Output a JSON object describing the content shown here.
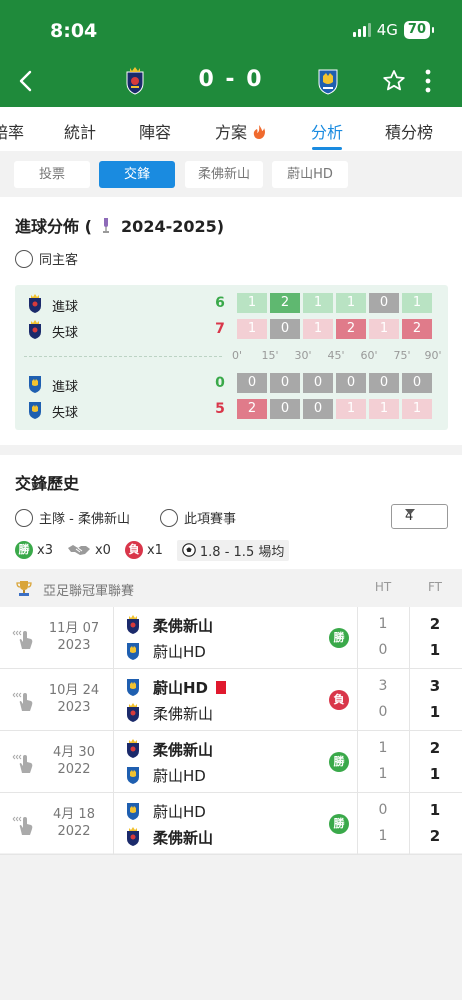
{
  "status_bar": {
    "time": "8:04",
    "network": "4G",
    "battery": "70"
  },
  "header": {
    "home_score": "0",
    "away_score": "0",
    "score_sep": "-"
  },
  "tabs": [
    {
      "label": "賠率"
    },
    {
      "label": "統計"
    },
    {
      "label": "陣容"
    },
    {
      "label": "方案"
    },
    {
      "label": "分析"
    },
    {
      "label": "積分榜"
    }
  ],
  "subtabs": [
    "投票",
    "交鋒",
    "柔佛新山",
    "蔚山HD"
  ],
  "goal_dist": {
    "title_prefix": "進球分佈 (",
    "season": "2024-2025)",
    "radio_label": "同主客",
    "home": {
      "scored": {
        "label": "進球",
        "total": "6",
        "cells": [
          "1",
          "2",
          "1",
          "1",
          "0",
          "1"
        ]
      },
      "conceded": {
        "label": "失球",
        "total": "7",
        "cells": [
          "1",
          "0",
          "1",
          "2",
          "1",
          "2"
        ]
      }
    },
    "away": {
      "scored": {
        "label": "進球",
        "total": "0",
        "cells": [
          "0",
          "0",
          "0",
          "0",
          "0",
          "0"
        ]
      },
      "conceded": {
        "label": "失球",
        "total": "5",
        "cells": [
          "2",
          "0",
          "0",
          "1",
          "1",
          "1"
        ]
      }
    },
    "time_labels": [
      "0'",
      "15'",
      "30'",
      "45'",
      "60'",
      "75'",
      "90'"
    ]
  },
  "h2h": {
    "title": "交鋒歷史",
    "radio_home": "主隊 - 柔佛新山",
    "radio_comp": "此項賽事",
    "count": "4",
    "summary": {
      "win_badge": "勝",
      "win_count": "x3",
      "draw_count": "x0",
      "loss_badge": "負",
      "loss_count": "x1",
      "avg": "1.8 - 1.5 場均"
    },
    "league": "亞足聯冠軍聯賽",
    "ht_label": "HT",
    "ft_label": "FT",
    "matches": [
      {
        "date": "11月 07",
        "year": "2023",
        "team1": "柔佛新山",
        "team2": "蔚山HD",
        "result": "勝",
        "ht1": "1",
        "ht2": "0",
        "ft1": "2",
        "ft2": "1"
      },
      {
        "date": "10月 24",
        "year": "2023",
        "team1": "蔚山HD",
        "team2": "柔佛新山",
        "result": "負",
        "ht1": "3",
        "ht2": "0",
        "ft1": "3",
        "ft2": "1"
      },
      {
        "date": "4月 30",
        "year": "2022",
        "team1": "柔佛新山",
        "team2": "蔚山HD",
        "result": "勝",
        "ht1": "1",
        "ht2": "1",
        "ft1": "2",
        "ft2": "1"
      },
      {
        "date": "4月 18",
        "year": "2022",
        "team1": "蔚山HD",
        "team2": "柔佛新山",
        "result": "勝",
        "ht1": "0",
        "ht2": "1",
        "ft1": "1",
        "ft2": "2"
      }
    ]
  },
  "colors": {
    "header_green": "#1f8a3b",
    "accent_blue": "#1a8be0",
    "win_green": "#3aa94a",
    "loss_red": "#d9364a",
    "cell_green_light": "#b9e3c3",
    "cell_green_dark": "#5fb870",
    "cell_red_light": "#f3cfd4",
    "cell_red_dark": "#e07b8a",
    "cell_gray": "#a8a8a8"
  }
}
